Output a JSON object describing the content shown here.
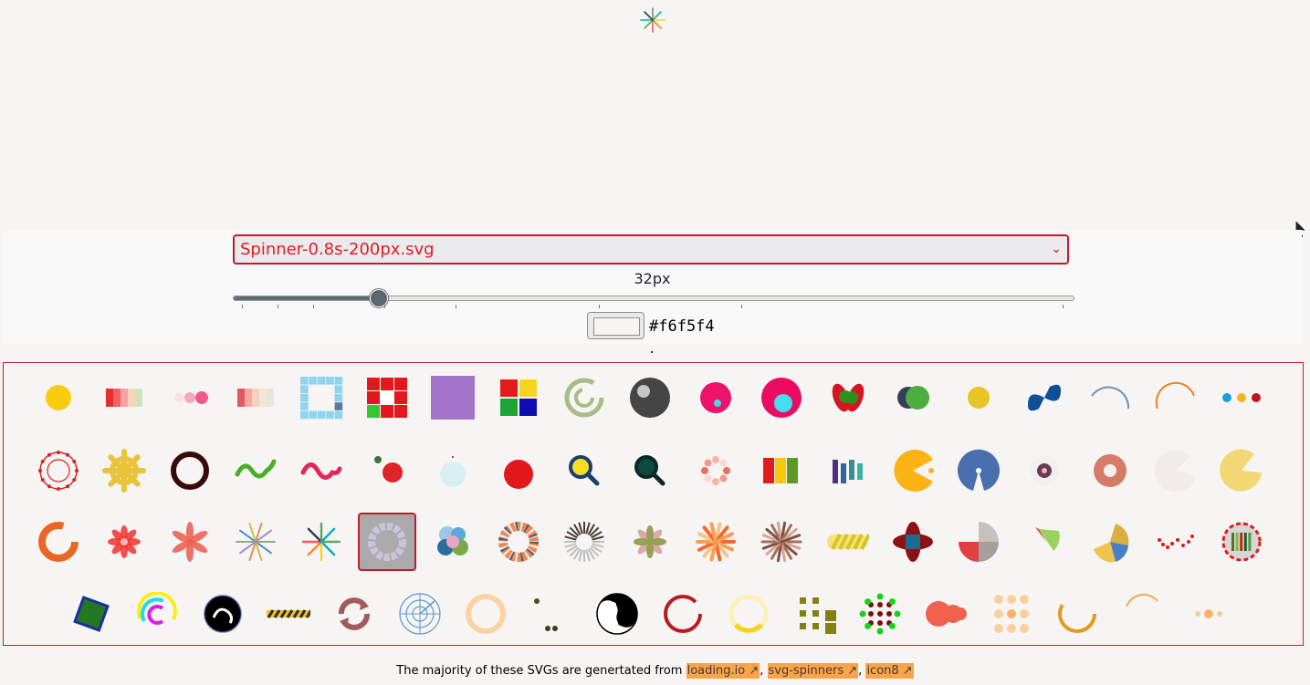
{
  "select": {
    "value": "Spinner-0.8s-200px.svg"
  },
  "size": {
    "label": "32px",
    "value": 32,
    "min": 12,
    "max": 200
  },
  "color": {
    "value": "#f6f5f4"
  },
  "icons": {
    "preview": "star-burst-spinner-icon",
    "cursor": "mouse-pointer-icon",
    "dropdown": "chevron-down-icon",
    "link": "external-link-icon"
  },
  "gallery": {
    "selected_index": 43,
    "rows": [
      [
        "circle-pulse",
        "gradient-bars",
        "pink-dots",
        "pastel-bars",
        "blue-square-grid",
        "red-blocks",
        "purple-square",
        "color-squares",
        "c-arrow",
        "dark-ball",
        "pink-ring-ball",
        "pink-cyan-circle",
        "red-green-bean",
        "dark-green-pair",
        "yellow-dot",
        "blue-infinity",
        "blue-arc",
        "orange-arc",
        "three-dots"
      ],
      [
        "red-network",
        "yellow-sun",
        "dark-ring",
        "green-wave",
        "pink-wave",
        "two-balls",
        "small-blue-circle",
        "red-circle",
        "search-yellow",
        "search-green",
        "pink-circle-dots",
        "color-bars",
        "bar-chart",
        "pacman-yellow",
        "blue-pie",
        "eye-circle",
        "salmon-donut",
        "pale-pie",
        "yellow-pie"
      ],
      [
        "orange-arc-ring",
        "red-flower",
        "coral-flower",
        "star-spinner",
        "star-burst-spinner",
        "lavender-ring",
        "blue-blobs",
        "striped-donut",
        "radial-lines",
        "leaf-spinner",
        "orange-burst",
        "brown-burst",
        "striped-capsule",
        "cross-quad",
        "pie-segments",
        "green-wedge",
        "color-pie",
        "red-dots-wave",
        "barrel-ring"
      ],
      [
        "blue-diamond",
        "cyan-magenta-arcs",
        "black-blob",
        "caution-stripe",
        "refresh-arrows",
        "radar",
        "peach-ring",
        "small-dots",
        "yin-yang",
        "red-ring",
        "pale-ring",
        "olive-squares",
        "green-red-dots",
        "red-blobs",
        "peach-dot-grid",
        "orange-ring",
        "thin-arc",
        "peach-dots-row"
      ]
    ]
  },
  "footer": {
    "text": "The majority of these SVGs are genertated from ",
    "links": [
      "loading.io",
      "svg-spinners",
      "icon8"
    ],
    "separator": ", "
  }
}
